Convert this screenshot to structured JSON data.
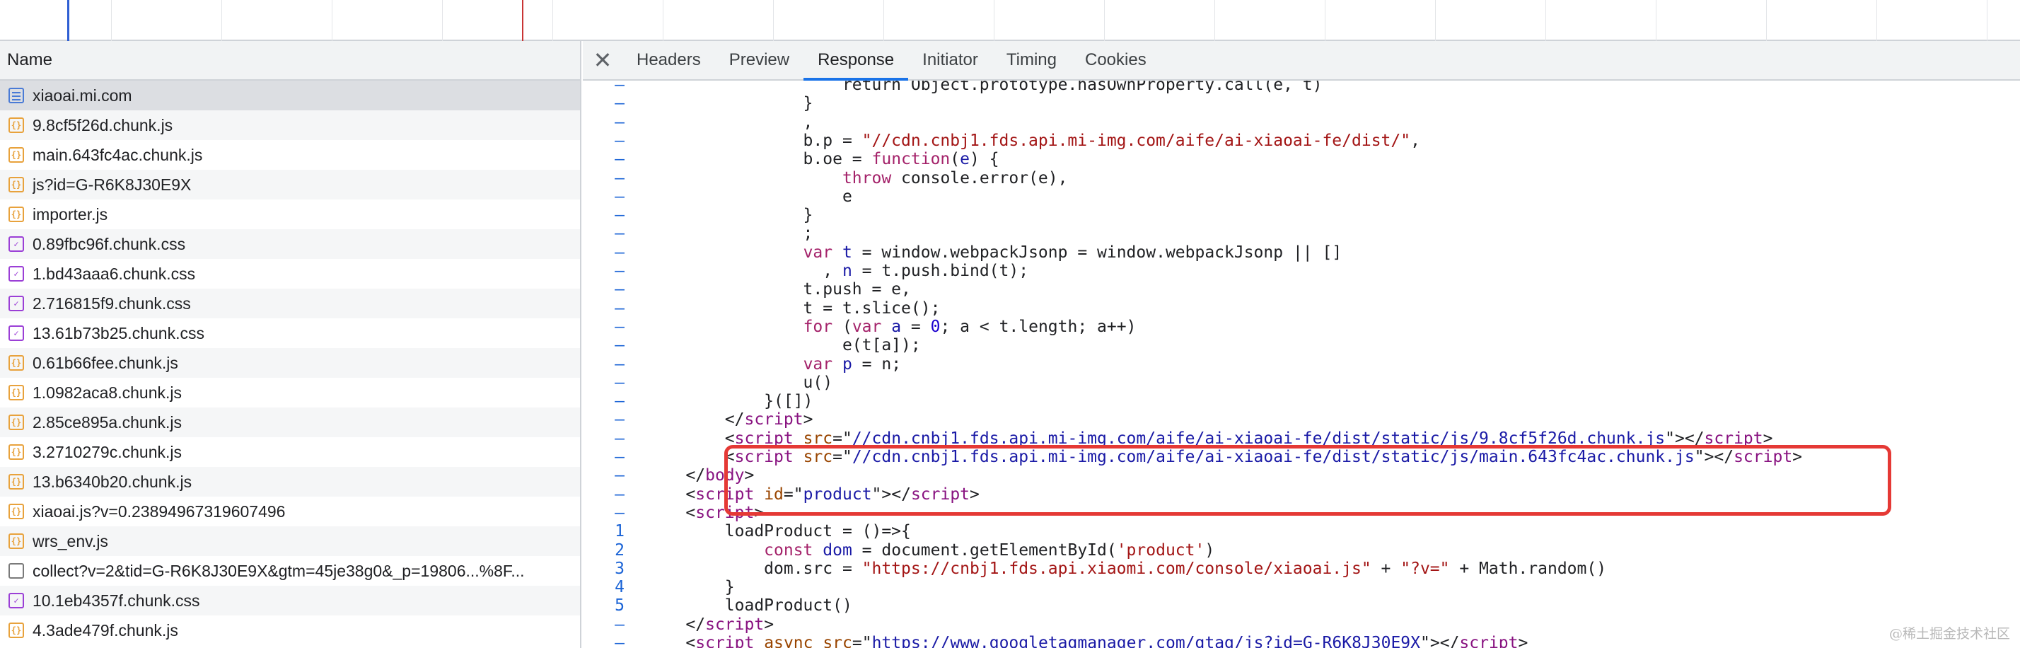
{
  "request_list": {
    "header": "Name",
    "items": [
      {
        "name": "xiaoai.mi.com",
        "type": "doc",
        "selected": true
      },
      {
        "name": "9.8cf5f26d.chunk.js",
        "type": "js"
      },
      {
        "name": "main.643fc4ac.chunk.js",
        "type": "js"
      },
      {
        "name": "js?id=G-R6K8J30E9X",
        "type": "js"
      },
      {
        "name": "importer.js",
        "type": "js"
      },
      {
        "name": "0.89fbc96f.chunk.css",
        "type": "css"
      },
      {
        "name": "1.bd43aaa6.chunk.css",
        "type": "css"
      },
      {
        "name": "2.716815f9.chunk.css",
        "type": "css"
      },
      {
        "name": "13.61b73b25.chunk.css",
        "type": "css"
      },
      {
        "name": "0.61b66fee.chunk.js",
        "type": "js"
      },
      {
        "name": "1.0982aca8.chunk.js",
        "type": "js"
      },
      {
        "name": "2.85ce895a.chunk.js",
        "type": "js"
      },
      {
        "name": "3.2710279c.chunk.js",
        "type": "js"
      },
      {
        "name": "13.b6340b20.chunk.js",
        "type": "js"
      },
      {
        "name": "xiaoai.js?v=0.23894967319607496",
        "type": "js"
      },
      {
        "name": "wrs_env.js",
        "type": "js"
      },
      {
        "name": "collect?v=2&tid=G-R6K8J30E9X&gtm=45je38g0&_p=19806...%8F...",
        "type": "other"
      },
      {
        "name": "10.1eb4357f.chunk.css",
        "type": "css"
      },
      {
        "name": "4.3ade479f.chunk.js",
        "type": "js"
      }
    ]
  },
  "details": {
    "tabs": [
      {
        "label": "Headers",
        "active": false
      },
      {
        "label": "Preview",
        "active": false
      },
      {
        "label": "Response",
        "active": true
      },
      {
        "label": "Initiator",
        "active": false
      },
      {
        "label": "Timing",
        "active": false
      },
      {
        "label": "Cookies",
        "active": false
      }
    ],
    "code_lines": [
      {
        "g": "–",
        "t": [
          [
            "",
            "                    return Object.prototype.hasOwnProperty.call(e, t)"
          ]
        ]
      },
      {
        "g": "–",
        "t": [
          [
            "",
            "                }"
          ]
        ]
      },
      {
        "g": "–",
        "t": [
          [
            "",
            "                ,"
          ]
        ]
      },
      {
        "g": "–",
        "t": [
          [
            "",
            "                b.p = "
          ],
          [
            "str",
            "\"//cdn.cnbj1.fds.api.mi-img.com/aife/ai-xiaoai-fe/dist/\""
          ],
          [
            "",
            ","
          ]
        ]
      },
      {
        "g": "–",
        "t": [
          [
            "",
            "                b.oe = "
          ],
          [
            "kw",
            "function"
          ],
          [
            "",
            "("
          ],
          [
            "var",
            "e"
          ],
          [
            "",
            ") {"
          ]
        ]
      },
      {
        "g": "–",
        "t": [
          [
            "",
            "                    "
          ],
          [
            "kw",
            "throw"
          ],
          [
            "",
            " console.error(e),"
          ]
        ]
      },
      {
        "g": "–",
        "t": [
          [
            "",
            "                    e"
          ]
        ]
      },
      {
        "g": "–",
        "t": [
          [
            "",
            "                }"
          ]
        ]
      },
      {
        "g": "–",
        "t": [
          [
            "",
            "                ;"
          ]
        ]
      },
      {
        "g": "–",
        "t": [
          [
            "",
            "                "
          ],
          [
            "kw",
            "var"
          ],
          [
            "",
            " "
          ],
          [
            "var",
            "t"
          ],
          [
            "",
            " = window.webpackJsonp = window.webpackJsonp || []"
          ]
        ]
      },
      {
        "g": "–",
        "t": [
          [
            "",
            "                  , "
          ],
          [
            "var",
            "n"
          ],
          [
            "",
            " = t.push.bind(t);"
          ]
        ]
      },
      {
        "g": "–",
        "t": [
          [
            "",
            "                t.push = e,"
          ]
        ]
      },
      {
        "g": "–",
        "t": [
          [
            "",
            "                t = t.slice();"
          ]
        ]
      },
      {
        "g": "–",
        "t": [
          [
            "",
            "                "
          ],
          [
            "kw",
            "for"
          ],
          [
            "",
            " ("
          ],
          [
            "kw",
            "var"
          ],
          [
            "",
            " "
          ],
          [
            "var",
            "a"
          ],
          [
            "",
            " = "
          ],
          [
            "num",
            "0"
          ],
          [
            "",
            "; a < t.length; a++)"
          ]
        ]
      },
      {
        "g": "–",
        "t": [
          [
            "",
            "                    e(t[a]);"
          ]
        ]
      },
      {
        "g": "–",
        "t": [
          [
            "",
            "                "
          ],
          [
            "kw",
            "var"
          ],
          [
            "",
            " "
          ],
          [
            "var",
            "p"
          ],
          [
            "",
            " = n;"
          ]
        ]
      },
      {
        "g": "–",
        "t": [
          [
            "",
            "                u()"
          ]
        ]
      },
      {
        "g": "–",
        "t": [
          [
            "",
            "            }([])"
          ]
        ]
      },
      {
        "g": "–",
        "t": [
          [
            "",
            "        </"
          ],
          [
            "tag",
            "script"
          ],
          [
            "",
            ">"
          ]
        ]
      },
      {
        "g": "–",
        "t": [
          [
            "",
            "        <"
          ],
          [
            "tag",
            "script"
          ],
          [
            "",
            " "
          ],
          [
            "attr",
            "src"
          ],
          [
            "",
            "=\""
          ],
          [
            "str-b",
            "//cdn.cnbj1.fds.api.mi-img.com/aife/ai-xiaoai-fe/dist/static/js/9.8cf5f26d.chunk.js"
          ],
          [
            "",
            "\"></"
          ],
          [
            "tag",
            "script"
          ],
          [
            "",
            ">"
          ]
        ]
      },
      {
        "g": "–",
        "t": [
          [
            "",
            "        <"
          ],
          [
            "tag",
            "script"
          ],
          [
            "",
            " "
          ],
          [
            "attr",
            "src"
          ],
          [
            "",
            "=\""
          ],
          [
            "str-b",
            "//cdn.cnbj1.fds.api.mi-img.com/aife/ai-xiaoai-fe/dist/static/js/main.643fc4ac.chunk.js"
          ],
          [
            "",
            "\"></"
          ],
          [
            "tag",
            "script"
          ],
          [
            "",
            ">"
          ]
        ]
      },
      {
        "g": "–",
        "t": [
          [
            "",
            "    </"
          ],
          [
            "tag",
            "body"
          ],
          [
            "",
            ">"
          ]
        ]
      },
      {
        "g": "–",
        "t": [
          [
            "",
            "    <"
          ],
          [
            "tag",
            "script"
          ],
          [
            "",
            " "
          ],
          [
            "attr",
            "id"
          ],
          [
            "",
            "=\""
          ],
          [
            "str-b",
            "product"
          ],
          [
            "",
            "\"></"
          ],
          [
            "tag",
            "script"
          ],
          [
            "",
            ">"
          ]
        ]
      },
      {
        "g": "–",
        "t": [
          [
            "",
            "    <"
          ],
          [
            "tag",
            "script"
          ],
          [
            "",
            ">"
          ]
        ]
      },
      {
        "g": "1",
        "t": [
          [
            "",
            "        loadProduct = ()=>{"
          ]
        ]
      },
      {
        "g": "2",
        "t": [
          [
            "",
            "            "
          ],
          [
            "kw",
            "const"
          ],
          [
            "",
            " "
          ],
          [
            "var",
            "dom"
          ],
          [
            "",
            " = document.getElementById("
          ],
          [
            "str",
            "'product'"
          ],
          [
            "",
            ")"
          ]
        ]
      },
      {
        "g": "3",
        "t": [
          [
            "",
            "            dom.src = "
          ],
          [
            "str",
            "\"https://cnbj1.fds.api.xiaomi.com/console/xiaoai.js\""
          ],
          [
            "",
            " + "
          ],
          [
            "str",
            "\"?v=\""
          ],
          [
            "",
            " + Math.random()"
          ]
        ]
      },
      {
        "g": "4",
        "t": [
          [
            "",
            "        }"
          ]
        ]
      },
      {
        "g": "5",
        "t": [
          [
            "",
            "        loadProduct()"
          ]
        ]
      },
      {
        "g": "–",
        "t": [
          [
            "",
            "    </"
          ],
          [
            "tag",
            "script"
          ],
          [
            "",
            ">"
          ]
        ]
      },
      {
        "g": "–",
        "t": [
          [
            "",
            "    <"
          ],
          [
            "tag",
            "script"
          ],
          [
            "",
            " "
          ],
          [
            "attr",
            "async"
          ],
          [
            "",
            " "
          ],
          [
            "attr",
            "src"
          ],
          [
            "",
            "=\""
          ],
          [
            "str-b",
            "https://www.googletagmanager.com/gtag/js?id=G-R6K8J30E9X"
          ],
          [
            "",
            "\"></"
          ],
          [
            "tag",
            "script"
          ],
          [
            "",
            ">"
          ]
        ]
      }
    ]
  },
  "watermark": "@稀土掘金技术社区",
  "colors": {
    "tab_active_underline": "#1a73e8",
    "highlight_box": "#e53935",
    "timeline_marker_blue": "#2f5fd3",
    "timeline_marker_red": "#c93434"
  }
}
